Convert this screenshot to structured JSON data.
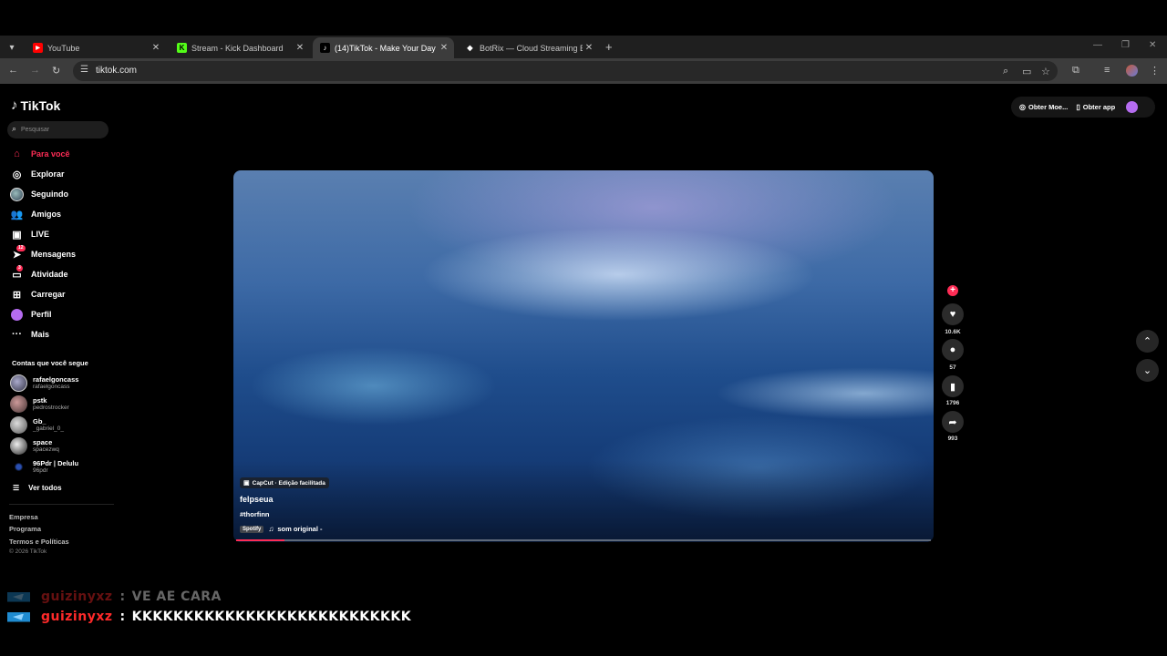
{
  "browser": {
    "tabs": [
      {
        "title": "YouTube",
        "favicon": "youtube-icon"
      },
      {
        "title": "Stream - Kick Dashboard",
        "favicon": "kick-icon"
      },
      {
        "title": "(14)TikTok - Make Your Day",
        "favicon": "tiktok-icon"
      },
      {
        "title": "BotRix — Cloud Streaming Bot",
        "favicon": "botrix-icon"
      }
    ],
    "active_tab_index": 2,
    "url": "tiktok.com"
  },
  "tiktok": {
    "logo_text": "TikTok",
    "search_placeholder": "Pesquisar",
    "nav": [
      {
        "label": "Para você",
        "icon": "home-icon"
      },
      {
        "label": "Explorar",
        "icon": "compass-icon"
      },
      {
        "label": "Seguindo",
        "icon": "avatar-icon"
      },
      {
        "label": "Amigos",
        "icon": "friends-icon"
      },
      {
        "label": "LIVE",
        "icon": "live-icon"
      },
      {
        "label": "Mensagens",
        "icon": "messages-icon",
        "badge": "12"
      },
      {
        "label": "Atividade",
        "icon": "activity-icon",
        "badge": "3"
      },
      {
        "label": "Carregar",
        "icon": "upload-icon"
      },
      {
        "label": "Perfil",
        "icon": "profile-icon"
      },
      {
        "label": "Mais",
        "icon": "more-icon"
      }
    ],
    "following_title": "Contas que você segue",
    "following": [
      {
        "name": "rafaelgoncass",
        "handle": "rafaelgoncass"
      },
      {
        "name": "pstk",
        "handle": "pedrostrocker"
      },
      {
        "name": "Gb_",
        "handle": "_gabriel_0_"
      },
      {
        "name": "space",
        "handle": "spacezwq"
      },
      {
        "name": "96Pdr | Delulu",
        "handle": "96pdr"
      }
    ],
    "see_all": "Ver todos",
    "footer": [
      "Empresa",
      "Programa",
      "Termos e Políticas"
    ],
    "copyright": "© 2026 TikTok",
    "topright": {
      "coins": "Obter Moe...",
      "app": "Obter app"
    },
    "video": {
      "capcut": "CapCut · Edição facilitada",
      "author": "felpseua",
      "hashtag": "#thorfinn",
      "music_tag": "Spotify",
      "music": "som original -",
      "progress": 0.07
    },
    "actions": {
      "likes": "10.6K",
      "comments": "57",
      "saves": "1796",
      "shares": "993"
    }
  },
  "chat": [
    {
      "user": "guizinyxz",
      "message": "VE AE CARA"
    },
    {
      "user": "guizinyxz",
      "message": "KKKKKKKKKKKKKKKKKKKKKKKKKKK"
    }
  ],
  "colors": {
    "accent": "#fe2c55",
    "chat_user": "#ff2a2a"
  }
}
